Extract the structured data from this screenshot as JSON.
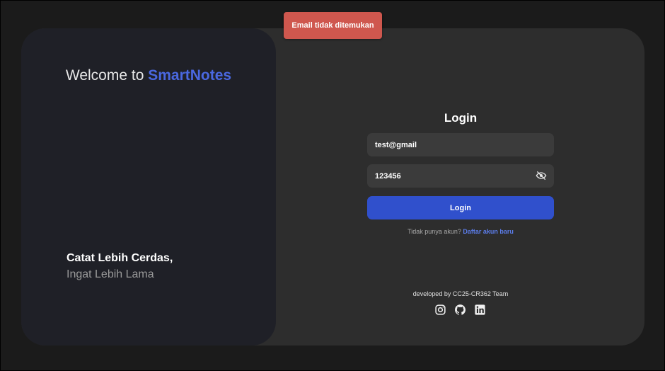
{
  "toast": {
    "message": "Email tidak ditemukan"
  },
  "hero": {
    "welcome_prefix": "Welcome to ",
    "brand": "SmartNotes",
    "tagline_catat": "Catat ",
    "tagline_bold": "Lebih Cerdas,",
    "tagline_line2": "Ingat Lebih Lama"
  },
  "login": {
    "title": "Login",
    "email_value": "test@gmail",
    "password_value": "123456",
    "submit_label": "Login",
    "signup_prompt": "Tidak punya akun? ",
    "signup_link": "Daftar akun baru"
  },
  "footer": {
    "developed_by": "developed by CC25-CR362 Team",
    "icons": [
      "instagram-icon",
      "github-icon",
      "linkedin-icon"
    ]
  },
  "colors": {
    "accent": "#3050cc",
    "brand": "#4a68e0",
    "toast_bg": "#cf574e"
  }
}
